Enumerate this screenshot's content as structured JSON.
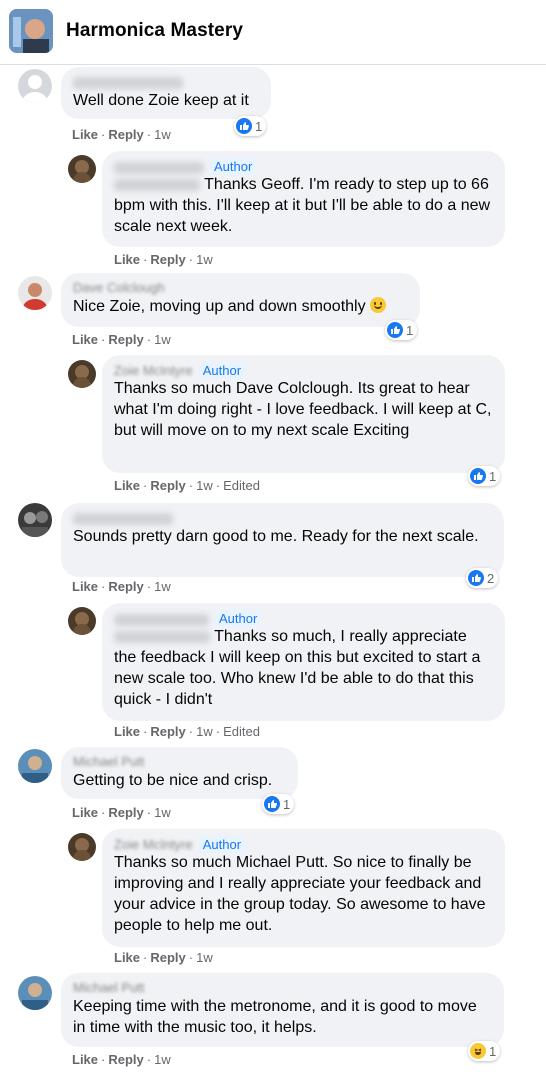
{
  "header": {
    "title": "Harmonica Mastery"
  },
  "author_label": "Author",
  "actions": {
    "like": "Like",
    "reply": "Reply"
  },
  "comments": [
    {
      "text": "Well done Zoie keep at it",
      "time": "1w",
      "reactions": "1",
      "reaction_type": "like-icon"
    },
    {
      "text": "Thanks Geoff. I'm ready to step up to 66 bpm with this. I'll keep at it but I'll be able to do a new scale next week.",
      "time": "1w"
    },
    {
      "name": "Dave Colclough",
      "text": "Nice Zoie, moving up and down smoothly",
      "time": "1w",
      "reactions": "1",
      "reaction_type": "like-icon"
    },
    {
      "name_blur": "Zoie McIntyre",
      "text": "Thanks so much Dave Colclough. Its great to hear what I'm doing right - I love feedback. I will keep at C, but will move on to my next scale Exciting",
      "time": "1w",
      "edited": "Edited",
      "reactions": "1",
      "reaction_type": "like-icon"
    },
    {
      "text": "Sounds pretty darn good to me. Ready for the next scale.",
      "time": "1w",
      "reactions": "2",
      "reaction_type": "like-icon"
    },
    {
      "text": "Thanks so much, I really appreciate the feedback I will keep on this but excited to start a new scale too. Who knew I'd be able to do that this quick - I didn't",
      "time": "1w",
      "edited": "Edited"
    },
    {
      "name": "Michael Putt",
      "text": "Getting to be nice and crisp.",
      "time": "1w",
      "reactions": "1",
      "reaction_type": "like-icon"
    },
    {
      "text": "Thanks so much Michael Putt. So nice to finally be improving and I really appreciate your feedback and your advice in the group today. So awesome to have people to help me out.",
      "time": "1w"
    },
    {
      "name": "Michael Putt",
      "text": "Keeping time with the metronome, and it is good to move in time with the music too, it helps.",
      "time": "1w",
      "reactions": "1",
      "reaction_type": "haha-icon"
    }
  ]
}
